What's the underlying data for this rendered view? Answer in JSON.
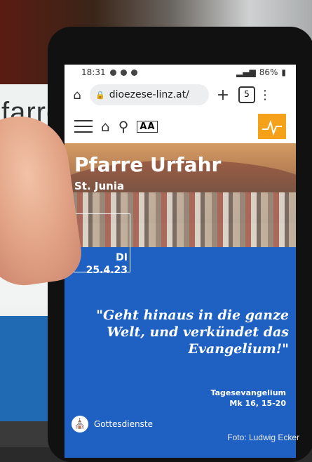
{
  "background": {
    "sign_text": "farre"
  },
  "status_bar": {
    "time": "18:31",
    "battery": "86%"
  },
  "browser": {
    "url": "dioezese-linz.at/",
    "tab_count": "5"
  },
  "site": {
    "aa_label": "AA",
    "hero_title": "Pfarre Urfahr",
    "hero_subtitle": "St. Junia",
    "date_day": "DI",
    "date_value": "25.4.23",
    "quote": "\"Geht hinaus in die ganze Welt, und verkündet das Evangelium!\"",
    "source_line1": "Tagesevangelium",
    "source_line2": "Mk 16, 15-20",
    "gottesdienste_label": "Gottesdienste"
  },
  "photo_credit": "Foto: Ludwig Ecker",
  "colors": {
    "accent_blue": "#1f61c2",
    "logo_orange": "#f5a21a"
  }
}
